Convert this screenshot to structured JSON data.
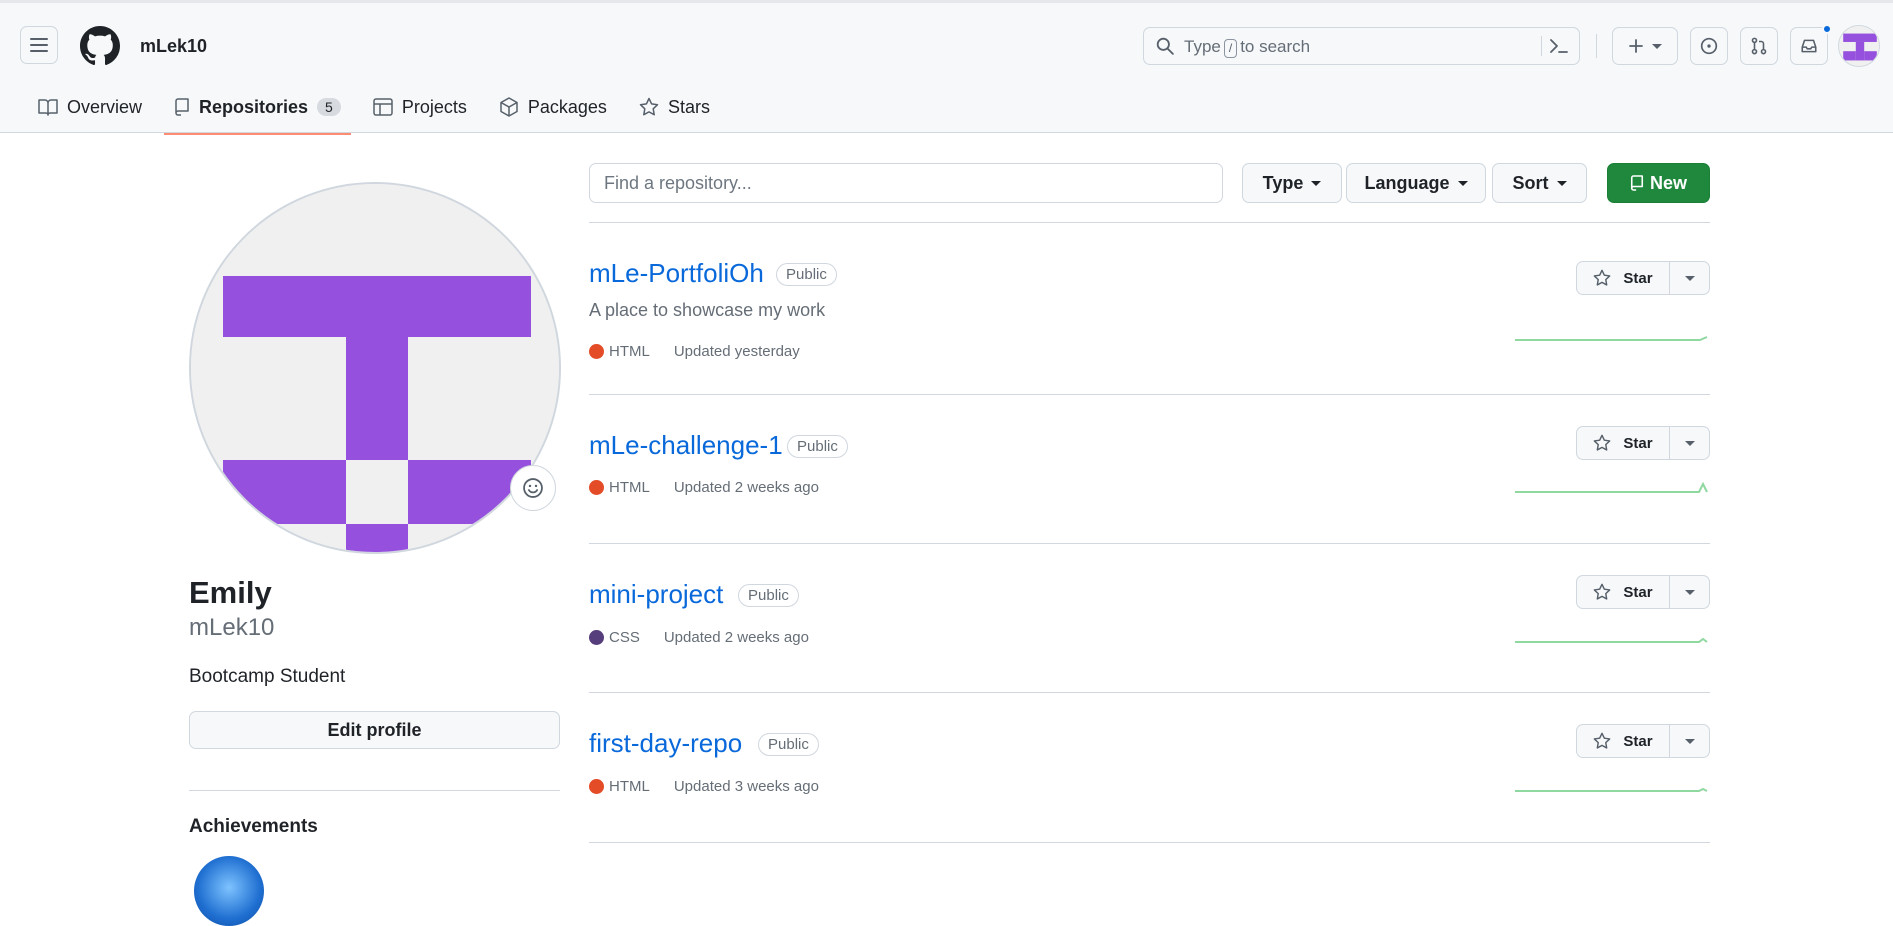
{
  "header": {
    "username": "mLek10",
    "search_placeholder_pre": "Type",
    "search_key": "/",
    "search_placeholder_post": "to search"
  },
  "nav": {
    "tabs": [
      {
        "label": "Overview",
        "icon": "book-icon"
      },
      {
        "label": "Repositories",
        "icon": "repo-icon",
        "count": "5",
        "active": true
      },
      {
        "label": "Projects",
        "icon": "table-icon"
      },
      {
        "label": "Packages",
        "icon": "package-icon"
      },
      {
        "label": "Stars",
        "icon": "star-icon"
      }
    ]
  },
  "profile": {
    "name": "Emily",
    "login": "mLek10",
    "bio": "Bootcamp Student",
    "edit_label": "Edit profile",
    "achievements_title": "Achievements"
  },
  "filters": {
    "find_placeholder": "Find a repository...",
    "type_label": "Type",
    "language_label": "Language",
    "sort_label": "Sort",
    "new_label": "New"
  },
  "repos": [
    {
      "name": "mLe-PortfoliOh",
      "visibility": "Public",
      "description": "A place to showcase my work",
      "language": "HTML",
      "lang_color": "#e34c26",
      "updated": "Updated yesterday",
      "star_label": "Star"
    },
    {
      "name": "mLe-challenge-1",
      "visibility": "Public",
      "description": "",
      "language": "HTML",
      "lang_color": "#e34c26",
      "updated": "Updated 2 weeks ago",
      "star_label": "Star"
    },
    {
      "name": "mini-project",
      "visibility": "Public",
      "description": "",
      "language": "CSS",
      "lang_color": "#563d7c",
      "updated": "Updated 2 weeks ago",
      "star_label": "Star"
    },
    {
      "name": "first-day-repo",
      "visibility": "Public",
      "description": "",
      "language": "HTML",
      "lang_color": "#e34c26",
      "updated": "Updated 3 weeks ago",
      "star_label": "Star"
    }
  ],
  "colors": {
    "accent": "#0969da",
    "brand_purple": "#9551dd",
    "new_button": "#1f883d",
    "spark_green": "#8fd8a0"
  }
}
